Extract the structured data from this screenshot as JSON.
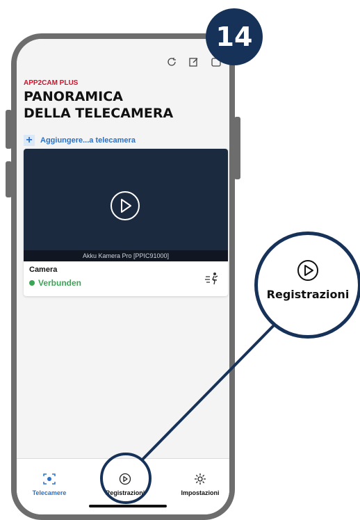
{
  "step_number": "14",
  "app": {
    "brand": "APP2CAM PLUS",
    "title_line1": "PANORAMICA",
    "title_line2": "DELLA TELECAMERA"
  },
  "toolbar": {
    "icons": [
      "refresh-icon",
      "edit-icon",
      "more-icon"
    ]
  },
  "add_camera": {
    "label": "Aggiungere...a telecamera"
  },
  "camera_card": {
    "video_caption": "Akku Kamera Pro [PPIC91000]",
    "name": "Camera",
    "status": "Verbunden",
    "status_color": "#3aa655"
  },
  "tabs": [
    {
      "label": "Telecamere",
      "icon": "camera-icon",
      "active": true
    },
    {
      "label": "Registrazioni",
      "icon": "play-circle-icon",
      "active": false
    },
    {
      "label": "Impostazioni",
      "icon": "gear-icon",
      "active": false
    }
  ],
  "callout": {
    "label": "Registrazioni",
    "icon": "play-circle-icon"
  },
  "colors": {
    "brand_red": "#d1112a",
    "accent_blue": "#2a71c7",
    "callout_navy": "#173259"
  }
}
